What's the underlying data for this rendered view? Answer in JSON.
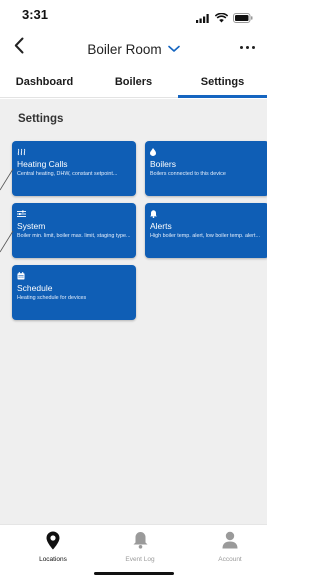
{
  "status_bar": {
    "time": "3:31",
    "signal_icon": "signal-icon",
    "wifi_icon": "wifi-icon",
    "battery_icon": "battery-icon"
  },
  "nav": {
    "back_icon": "chevron-left-icon",
    "title": "Boiler Room",
    "dropdown_icon": "chevron-down-icon",
    "more_icon": "ellipsis-icon"
  },
  "tabs": [
    {
      "label": "Dashboard",
      "active": false
    },
    {
      "label": "Boilers",
      "active": false
    },
    {
      "label": "Settings",
      "active": true
    }
  ],
  "section_title": "Settings",
  "cards": [
    {
      "icon": "heating-waves-icon",
      "title": "Heating Calls",
      "description": "Central heating, DHW, constant setpoint..."
    },
    {
      "icon": "flame-icon",
      "title": "Boilers",
      "description": "Boilers connected to this device"
    },
    {
      "icon": "sliders-icon",
      "title": "System",
      "description": "Boiler min. limit, boiler max. limit, staging type..."
    },
    {
      "icon": "bell-icon",
      "title": "Alerts",
      "description": "High boiler temp. alert, low boiler temp. alert..."
    },
    {
      "icon": "calendar-icon",
      "title": "Schedule",
      "description": "Heating schedule for devices"
    }
  ],
  "bottom_nav": [
    {
      "icon": "location-pin-icon",
      "label": "Locations",
      "active": true
    },
    {
      "icon": "bell-icon",
      "label": "Event Log",
      "active": false
    },
    {
      "icon": "user-icon",
      "label": "Account",
      "active": false
    }
  ],
  "colors": {
    "accent": "#1565c0",
    "card": "#0f5eb5",
    "background": "#efefef",
    "inactive": "#9a9a9a"
  }
}
